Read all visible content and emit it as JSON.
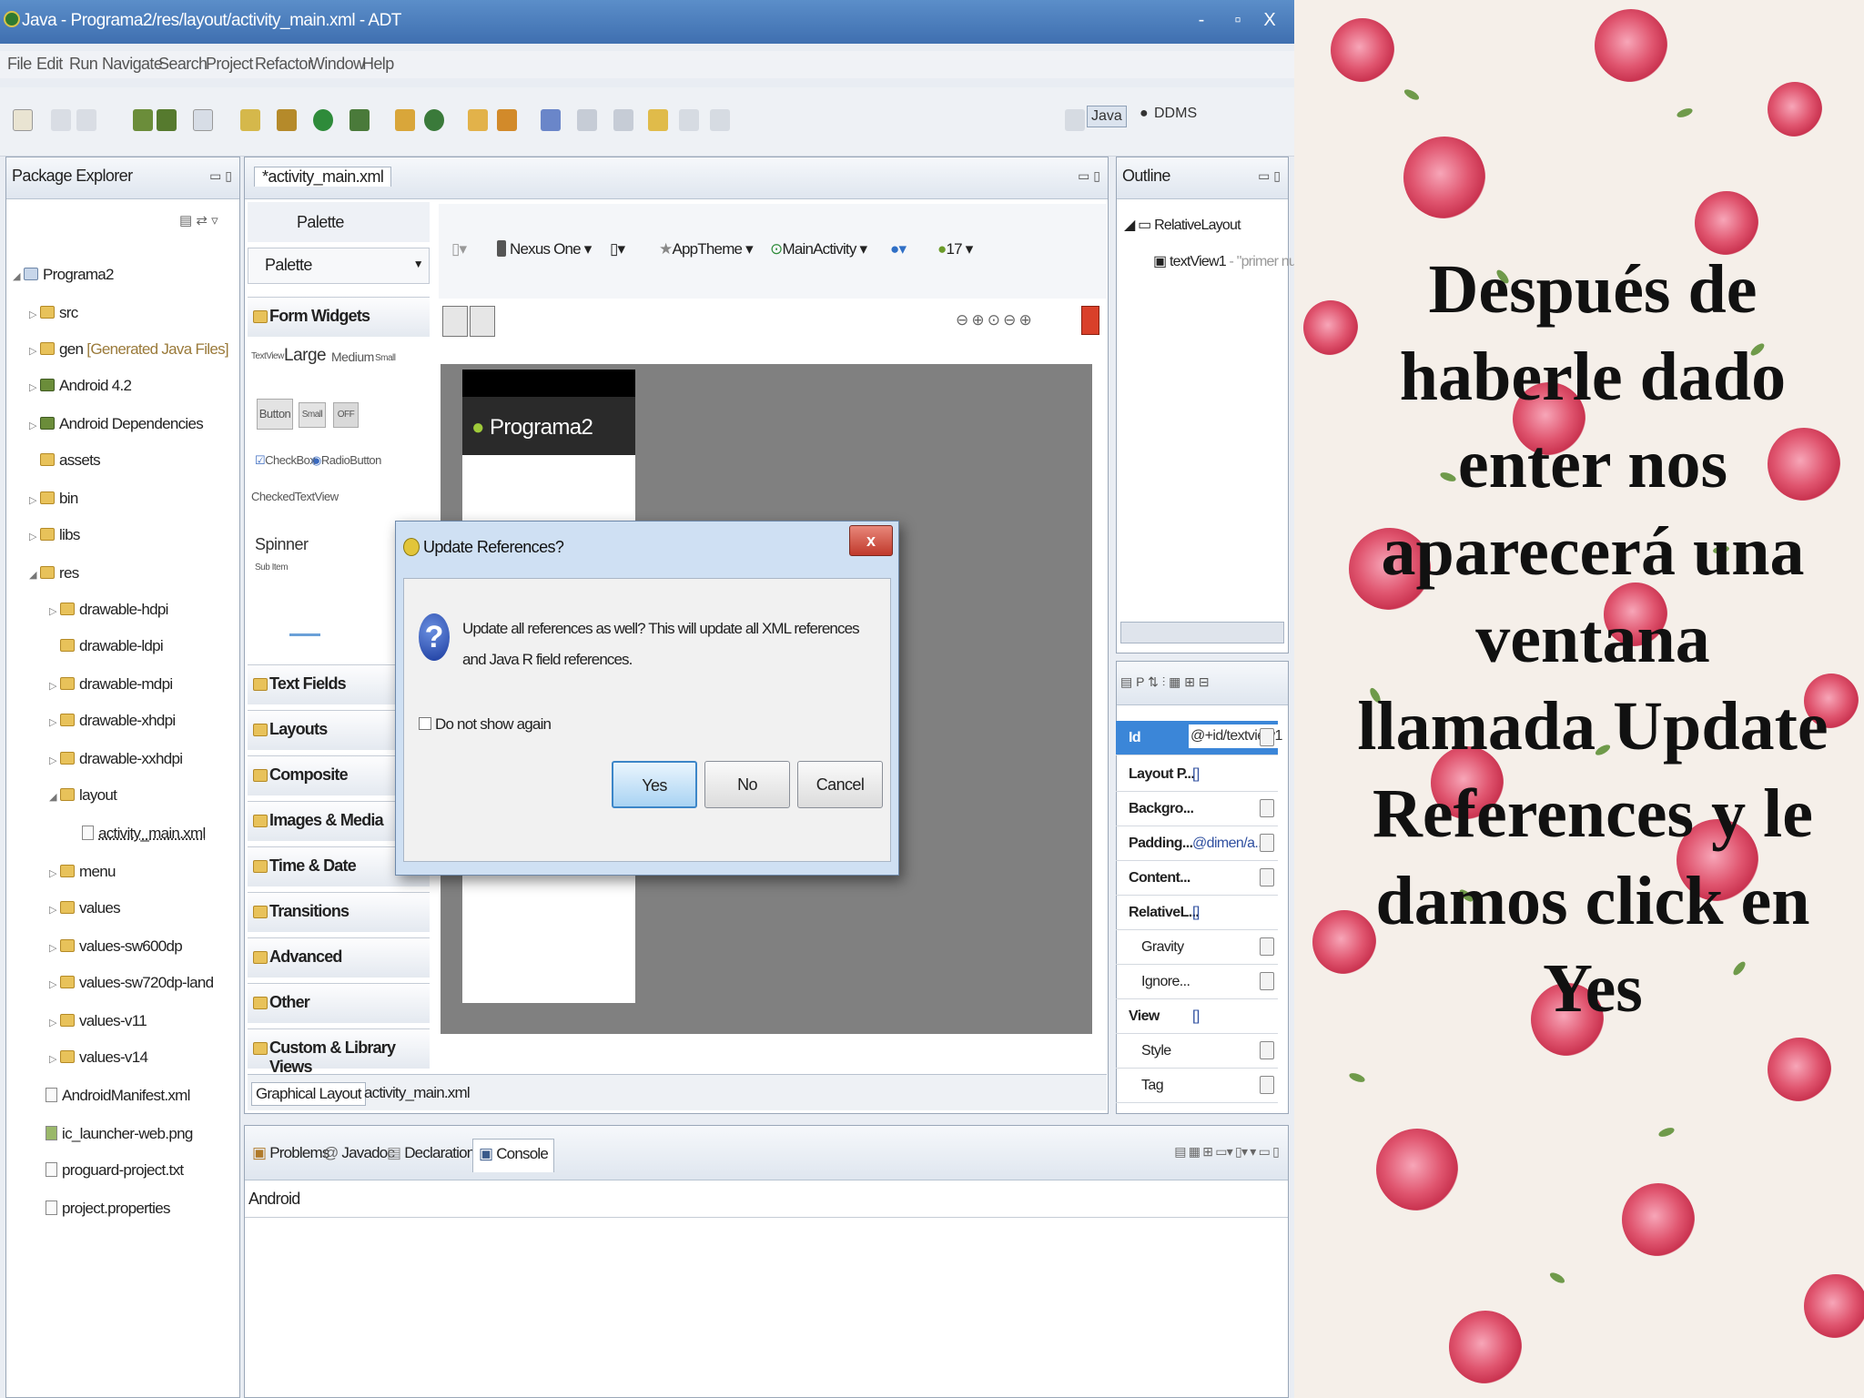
{
  "window": {
    "title": "Java - Programa2/res/layout/activity_main.xml - ADT",
    "buttons": {
      "minimize": "-",
      "maximize": "▫",
      "close": "X"
    }
  },
  "menu": [
    "File",
    "Edit",
    "Run",
    "Navigate",
    "Search",
    "Project",
    "Refactor",
    "Window",
    "Help"
  ],
  "perspectives": [
    "Java",
    "DDMS"
  ],
  "package_explorer": {
    "tab_label": "Package Explorer",
    "items": [
      {
        "label": "Programa2",
        "extra": ""
      },
      {
        "label": "src",
        "extra": ""
      },
      {
        "label": "gen",
        "extra": "[Generated Java Files]"
      },
      {
        "label": "Android 4.2",
        "extra": ""
      },
      {
        "label": "Android Dependencies",
        "extra": ""
      },
      {
        "label": "assets",
        "extra": ""
      },
      {
        "label": "bin",
        "extra": ""
      },
      {
        "label": "libs",
        "extra": ""
      },
      {
        "label": "res",
        "extra": ""
      },
      {
        "label": "drawable-hdpi",
        "extra": ""
      },
      {
        "label": "drawable-ldpi",
        "extra": ""
      },
      {
        "label": "drawable-mdpi",
        "extra": ""
      },
      {
        "label": "drawable-xhdpi",
        "extra": ""
      },
      {
        "label": "drawable-xxhdpi",
        "extra": ""
      },
      {
        "label": "layout",
        "extra": ""
      },
      {
        "label": "activity_main.xml",
        "extra": ""
      },
      {
        "label": "menu",
        "extra": ""
      },
      {
        "label": "values",
        "extra": ""
      },
      {
        "label": "values-sw600dp",
        "extra": ""
      },
      {
        "label": "values-sw720dp-land",
        "extra": ""
      },
      {
        "label": "values-v11",
        "extra": ""
      },
      {
        "label": "values-v14",
        "extra": ""
      },
      {
        "label": "AndroidManifest.xml",
        "extra": ""
      },
      {
        "label": "ic_launcher-web.png",
        "extra": ""
      },
      {
        "label": "proguard-project.txt",
        "extra": ""
      },
      {
        "label": "project.properties",
        "extra": ""
      }
    ]
  },
  "editor": {
    "tab_label": "*activity_main.xml",
    "palette_header": "Palette",
    "palette_dropdown": "Palette",
    "device_toolbar": [
      "Nexus One",
      "AppTheme",
      "MainActivity",
      "17"
    ],
    "palette_categories": [
      "Form Widgets",
      "Text Fields",
      "Layouts",
      "Composite",
      "Images & Media",
      "Time & Date",
      "Transitions",
      "Advanced",
      "Other",
      "Custom & Library Views"
    ],
    "form_widgets": {
      "textview_sizes": [
        "TextView",
        "Large",
        "Medium",
        "Small"
      ],
      "buttons": [
        "Button",
        "Small",
        "OFF"
      ],
      "checks": [
        "CheckBox",
        "RadioButton"
      ],
      "checked_text": "CheckedTextView",
      "spinner": "Spinner",
      "spinner_sub": "Sub Item"
    },
    "app_title": "Programa2",
    "bottom_tabs": [
      "Graphical Layout",
      "activity_main.xml"
    ]
  },
  "dialog": {
    "title": "Update References?",
    "close": "x",
    "message": "Update all references as well? This will update all XML references and Java R field references.",
    "checkbox_label": "Do not show again",
    "buttons": {
      "yes": "Yes",
      "no": "No",
      "cancel": "Cancel"
    }
  },
  "outline": {
    "tab_label": "Outline",
    "root": "RelativeLayout",
    "child": "textView1",
    "child_extra": "- \"primer nu"
  },
  "properties": [
    {
      "name": "Id",
      "value": "@+id/textview1"
    },
    {
      "name": "Layout P...",
      "value": "[]"
    },
    {
      "name": "Backgro...",
      "value": ""
    },
    {
      "name": "Padding...",
      "value": "@dimen/a..."
    },
    {
      "name": "Content...",
      "value": ""
    },
    {
      "name": "RelativeL...",
      "value": "[]"
    },
    {
      "name": "Gravity",
      "value": ""
    },
    {
      "name": "Ignore...",
      "value": ""
    },
    {
      "name": "View",
      "value": "[]"
    },
    {
      "name": "Style",
      "value": ""
    },
    {
      "name": "Tag",
      "value": ""
    }
  ],
  "console": {
    "tabs": [
      "Problems",
      "Javadoc",
      "Declaration",
      "Console"
    ],
    "content": "Android"
  },
  "slide": {
    "lines": [
      "Después  de",
      "haberle dado",
      "enter nos",
      "aparecerá una",
      "ventana",
      "llamada Update",
      "References  y le",
      "damos click en",
      "Yes"
    ]
  },
  "colors": {
    "titlebar": "#4a7dbd",
    "dialog_frame": "#cfe0f3",
    "canvas_gray": "#808080",
    "slide_text": "#111111"
  }
}
